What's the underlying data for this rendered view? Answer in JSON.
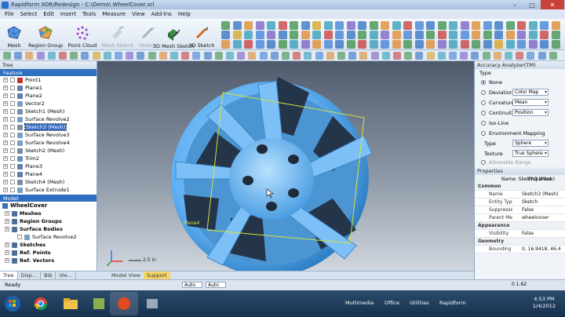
{
  "window": {
    "title": "Rapidform XOR/Redesign - C:\\Demo\\ WheelCover.xrl",
    "minimize": "–",
    "maximize": "□",
    "close": "✕"
  },
  "menu": [
    "File",
    "Select",
    "Edit",
    "Insert",
    "Tools",
    "Measure",
    "View",
    "Add-Ins",
    "Help"
  ],
  "ribbon": {
    "buttons": [
      {
        "label": "Mesh",
        "color": "#3c7ed6",
        "enabled": true
      },
      {
        "label": "Region Group",
        "color": "#e0872b",
        "enabled": true
      },
      {
        "label": "Point Cloud",
        "color": "#9c3cc4",
        "enabled": true
      },
      {
        "label": "Mesh Sketch",
        "color": "#b9c2cc",
        "enabled": false
      },
      {
        "label": "Sketch",
        "color": "#b9c2cc",
        "enabled": false
      },
      {
        "label": "3D Mesh Sketch",
        "color": "#3a8d45",
        "enabled": true
      },
      {
        "label": "3D Sketch",
        "color": "#d06a2a",
        "enabled": true
      }
    ]
  },
  "tree_panel": {
    "header": "Tree",
    "feature_section": "Feature",
    "feature_items": [
      {
        "label": "Point1",
        "icon": "point-icon",
        "selected": false
      },
      {
        "label": "Plane1",
        "icon": "plane-icon",
        "selected": false
      },
      {
        "label": "Plane2",
        "icon": "plane-icon",
        "selected": false
      },
      {
        "label": "Vector2",
        "icon": "vector-icon",
        "selected": false
      },
      {
        "label": "Sketch1 (Mesh)",
        "icon": "sketch-icon",
        "selected": false
      },
      {
        "label": "Surface Revolve2",
        "icon": "surface-icon",
        "selected": false
      },
      {
        "label": "Sketch3 (Mesh)",
        "icon": "sketch-icon",
        "selected": true
      },
      {
        "label": "Surface Revolve3",
        "icon": "surface-icon",
        "selected": false
      },
      {
        "label": "Surface Revolve4",
        "icon": "surface-icon",
        "selected": false
      },
      {
        "label": "Sketch2 (Mesh)",
        "icon": "sketch-icon",
        "selected": false
      },
      {
        "label": "Trim2",
        "icon": "trim-icon",
        "selected": false
      },
      {
        "label": "Plane3",
        "icon": "plane-icon",
        "selected": false
      },
      {
        "label": "Plane4",
        "icon": "plane-icon",
        "selected": false
      },
      {
        "label": "Sketch4 (Mesh)",
        "icon": "sketch-icon",
        "selected": false
      },
      {
        "label": "Surface Extrude1",
        "icon": "surface-icon",
        "selected": false
      }
    ],
    "model_section": "Model",
    "model_title": "WheelCover",
    "model_items": [
      {
        "label": "Meshes",
        "bold": true,
        "indent": 0
      },
      {
        "label": "Region Groups",
        "bold": true,
        "indent": 0
      },
      {
        "label": "Surface Bodies",
        "bold": true,
        "indent": 0
      },
      {
        "label": "Surface Revolve2",
        "bold": false,
        "indent": 1
      },
      {
        "label": "Sketches",
        "bold": true,
        "indent": 0
      },
      {
        "label": "Ref. Points",
        "bold": true,
        "indent": 0
      },
      {
        "label": "Ref. Vectors",
        "bold": true,
        "indent": 0
      }
    ],
    "tabs": [
      "Tree",
      "Disp...",
      "Bib",
      "Vie..."
    ]
  },
  "viewport": {
    "tabs": [
      "Model View",
      "Support"
    ],
    "plane_label": "Plane4",
    "scale_label": "2.5 in"
  },
  "accuracy_panel": {
    "header": "Accuracy Analyzer(TM)",
    "type_group": "Type",
    "options": [
      {
        "label": "None",
        "selected": true,
        "combo": ""
      },
      {
        "label": "Deviation",
        "selected": false,
        "combo": "Color Map"
      },
      {
        "label": "Curvature",
        "selected": false,
        "combo": "Mean"
      },
      {
        "label": "Continuity",
        "selected": false,
        "combo": "Position"
      },
      {
        "label": "Iso-Line",
        "selected": false,
        "combo": ""
      },
      {
        "label": "Environment Mapping",
        "selected": false,
        "combo": ""
      }
    ],
    "env_type_label": "Type",
    "env_type_value": "Sphere",
    "texture_label": "Texture",
    "texture_value": "True Sphere",
    "allowable_range": "Allowable Range"
  },
  "properties_panel": {
    "header": "Properties",
    "col_name": "Name: Sketch3 (Mesh)",
    "col_props": "Properties",
    "rows": [
      {
        "k": "Common",
        "v": "",
        "cat": true
      },
      {
        "k": "Name",
        "v": "Sketch3 (Mesh)",
        "cat": false
      },
      {
        "k": "Entity Type",
        "v": "Sketch",
        "cat": false
      },
      {
        "k": "Suppressed",
        "v": "False",
        "cat": false
      },
      {
        "k": "Parent Mesh",
        "v": "wheelcover",
        "cat": false
      },
      {
        "k": "Appearance",
        "v": "",
        "cat": true
      },
      {
        "k": "Visibility",
        "v": "False",
        "cat": false
      },
      {
        "k": "Geometry",
        "v": "",
        "cat": true
      },
      {
        "k": "Bounding ...",
        "v": "0, 16.9418, 46.4...",
        "cat": false
      }
    ]
  },
  "statusbar": {
    "ready": "Ready",
    "auto1": "Auto",
    "auto2": "Auto",
    "time_readout": "0 1.62"
  },
  "taskbar": {
    "links": [
      "Multimedia",
      "Office",
      "Utilities",
      "Rapidform"
    ],
    "time": "4:53 PM",
    "date": "1/4/2012"
  }
}
